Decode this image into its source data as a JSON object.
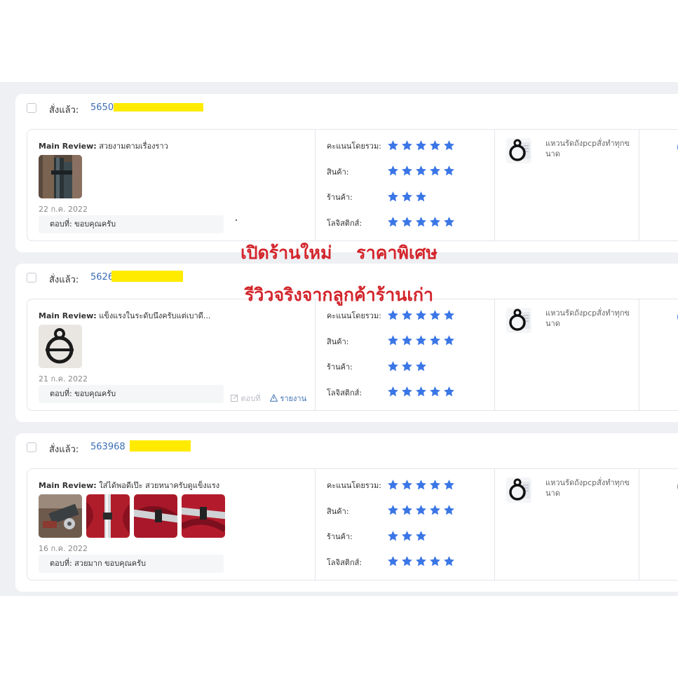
{
  "colors": {
    "star": "#3b76e6",
    "link": "#3d6fb4",
    "promo": "#d3262c",
    "redaction": "#ffeb00"
  },
  "common": {
    "ordered_label": "สั่งแล้ว:",
    "main_review_label": "Main Review:",
    "rating_labels": [
      "คะแนนโดยรวม:",
      "สินค้า:",
      "ร้านค้า:",
      "โลจิสติกส์:"
    ],
    "reply_action": "ตอบที่",
    "report_action": "รายงาน"
  },
  "promo": {
    "line1": "เปิดร้านใหม่    ราคาพิเศษ",
    "line2": "รีวิวจริงจากลูกค้าร้านเก่า"
  },
  "reviews": [
    {
      "order_no_visible": "5650",
      "review_text": "สวยงามตามเรื่องราว",
      "date": "22 ก.ค. 2022",
      "reply": "ตอบที่: ขอบคุณครับ",
      "ratings": [
        5,
        5,
        3,
        5
      ],
      "product_name": "แหวนรัดถังpcpสั่งทำทุกขนาด",
      "show_actions": false
    },
    {
      "order_no_visible": "5626",
      "review_text": "แข็งแรงในระดับนึงครับแต่เบาดี...",
      "date": "21 ก.ค. 2022",
      "reply": "ตอบที่: ขอบคุณครับ",
      "ratings": [
        5,
        5,
        3,
        5
      ],
      "product_name": "แหวนรัดถังpcpสั่งทำทุกขนาด",
      "show_actions": true
    },
    {
      "order_no_visible": "563968",
      "review_text": "ใส่ได้พอดีเป๊ะ สวยหนาครับดูแข็งแรง",
      "date": "16 ก.ค. 2022",
      "reply": "ตอบที่: สวยมาก ขอบคุณครับ",
      "ratings": [
        5,
        5,
        3,
        5
      ],
      "product_name": "แหวนรัดถังpcpสั่งทำทุกขนาด",
      "show_actions": false
    }
  ]
}
